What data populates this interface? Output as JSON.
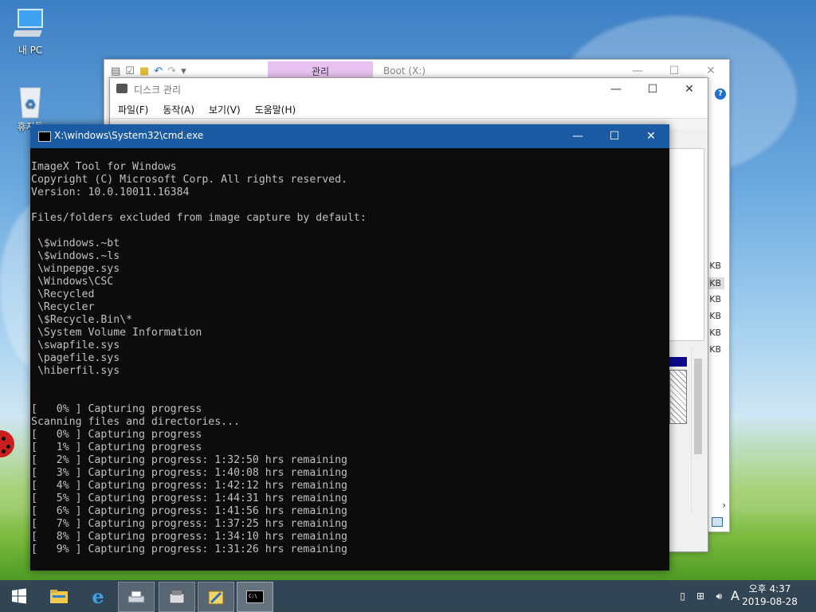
{
  "desktop": {
    "icons": [
      {
        "label": "내 PC",
        "icon": "computer-icon"
      },
      {
        "label": "휴지통",
        "icon": "recycle-bin-icon"
      }
    ]
  },
  "explorer": {
    "tab_manage": "관리",
    "title": "Boot (X:)",
    "help": "?",
    "sizes": [
      "KB",
      "KB",
      "KB",
      "KB",
      "KB",
      "KB"
    ]
  },
  "diskmgmt": {
    "title": "디스크 관리",
    "menu": [
      "파일(F)",
      "동작(A)",
      "보기(V)",
      "도움말(H)"
    ]
  },
  "cmd": {
    "title": "X:\\windows\\System32\\cmd.exe",
    "lines": [
      "ImageX Tool for Windows",
      "Copyright (C) Microsoft Corp. All rights reserved.",
      "Version: 10.0.10011.16384",
      "",
      "Files/folders excluded from image capture by default:",
      "",
      " \\$windows.~bt",
      " \\$windows.~ls",
      " \\winpepge.sys",
      " \\Windows\\CSC",
      " \\Recycled",
      " \\Recycler",
      " \\$Recycle.Bin\\*",
      " \\System Volume Information",
      " \\swapfile.sys",
      " \\pagefile.sys",
      " \\hiberfil.sys",
      "",
      "",
      "[   0% ] Capturing progress",
      "Scanning files and directories...",
      "[   0% ] Capturing progress",
      "[   1% ] Capturing progress",
      "[   2% ] Capturing progress: 1:32:50 hrs remaining",
      "[   3% ] Capturing progress: 1:40:08 hrs remaining",
      "[   4% ] Capturing progress: 1:42:12 hrs remaining",
      "[   5% ] Capturing progress: 1:44:31 hrs remaining",
      "[   6% ] Capturing progress: 1:41:56 hrs remaining",
      "[   7% ] Capturing progress: 1:37:25 hrs remaining",
      "[   8% ] Capturing progress: 1:34:10 hrs remaining",
      "[   9% ] Capturing progress: 1:31:26 hrs remaining"
    ]
  },
  "taskbar": {
    "apps": [
      "start-icon",
      "file-explorer-icon",
      "internet-explorer-icon",
      "disk-management-icon",
      "device-manager-icon",
      "tool-icon",
      "cmd-icon"
    ],
    "ime": "A",
    "time": "오후 4:37",
    "date": "2019-08-28"
  }
}
